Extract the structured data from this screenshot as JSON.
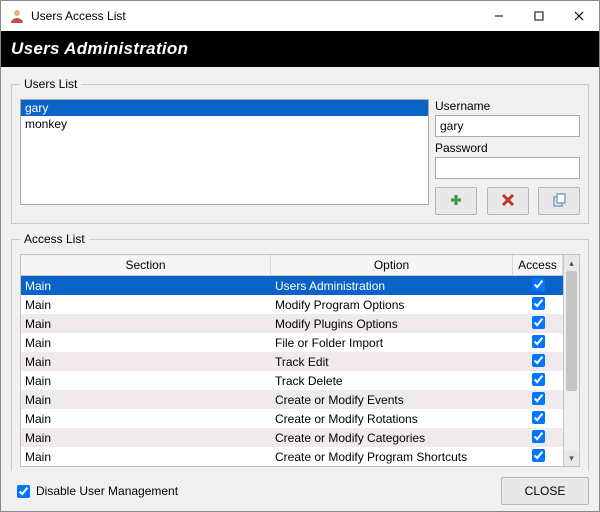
{
  "window": {
    "title": "Users Access List"
  },
  "banner": {
    "title": "Users Administration"
  },
  "users": {
    "legend": "Users List",
    "items": [
      "gary",
      "monkey"
    ],
    "selected_index": 0,
    "username_label": "Username",
    "username_value": "gary",
    "password_label": "Password",
    "password_value": ""
  },
  "access": {
    "legend": "Access List",
    "headers": {
      "section": "Section",
      "option": "Option",
      "access": "Access"
    },
    "selected_index": 0,
    "rows": [
      {
        "section": "Main",
        "option": "Users Administration",
        "access": true
      },
      {
        "section": "Main",
        "option": "Modify Program Options",
        "access": true
      },
      {
        "section": "Main",
        "option": "Modify Plugins Options",
        "access": true
      },
      {
        "section": "Main",
        "option": "File or Folder Import",
        "access": true
      },
      {
        "section": "Main",
        "option": "Track Edit",
        "access": true
      },
      {
        "section": "Main",
        "option": "Track Delete",
        "access": true
      },
      {
        "section": "Main",
        "option": "Create or Modify Events",
        "access": true
      },
      {
        "section": "Main",
        "option": "Create or Modify Rotations",
        "access": true
      },
      {
        "section": "Main",
        "option": "Create or Modify Categories",
        "access": true
      },
      {
        "section": "Main",
        "option": "Create or Modify Program Shortcuts",
        "access": true
      }
    ]
  },
  "footer": {
    "disable_label": "Disable User Management",
    "disable_checked": true,
    "close_label": "CLOSE"
  },
  "colors": {
    "selection": "#0a63c7",
    "banner_bg": "#000000",
    "banner_fg": "#ffffff",
    "row_alt": "#f1eaec"
  }
}
